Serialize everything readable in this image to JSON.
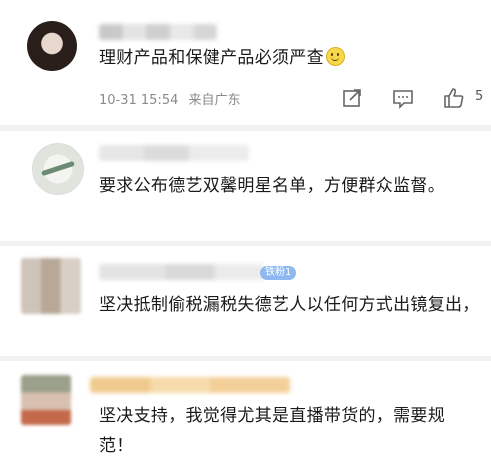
{
  "comments": [
    {
      "text": "理财产品和保健产品必须严查",
      "emoji": "smile-emoji",
      "time": "10-31 15:54",
      "location": "来自广东",
      "likes": "5"
    },
    {
      "text": "要求公布德艺双馨明星名单，方便群众监督。"
    },
    {
      "text": "坚决抵制偷税漏税失德艺人以任何方式出镜复出，",
      "badge": "铁粉1"
    },
    {
      "text": "坚决支持，我觉得尤其是直播带货的，需要规范！"
    }
  ],
  "icons": {
    "share": "share-icon",
    "comment": "comment-icon",
    "like": "thumbs-up-icon"
  }
}
